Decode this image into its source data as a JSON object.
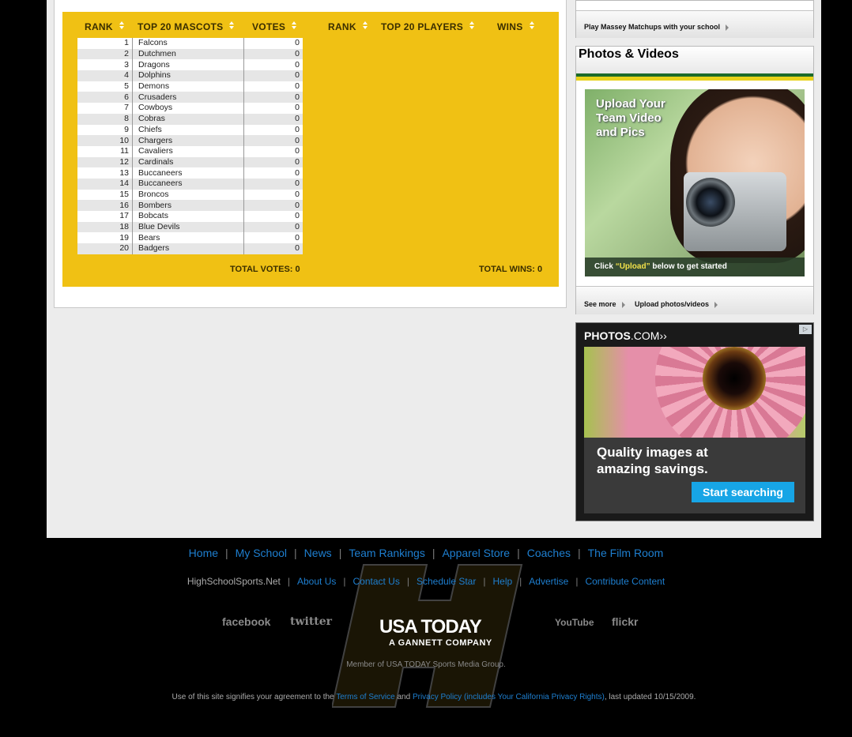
{
  "leaderboard": {
    "headers": {
      "rank1": "RANK",
      "mascots": "TOP 20 MASCOTS",
      "votes": "VOTES",
      "rank2": "RANK",
      "players": "TOP 20 PLAYERS",
      "wins": "WINS"
    },
    "mascots": [
      {
        "rank": "1",
        "name": "Falcons",
        "votes": "0"
      },
      {
        "rank": "2",
        "name": "Dutchmen",
        "votes": "0"
      },
      {
        "rank": "3",
        "name": "Dragons",
        "votes": "0"
      },
      {
        "rank": "4",
        "name": "Dolphins",
        "votes": "0"
      },
      {
        "rank": "5",
        "name": "Demons",
        "votes": "0"
      },
      {
        "rank": "6",
        "name": "Crusaders",
        "votes": "0"
      },
      {
        "rank": "7",
        "name": "Cowboys",
        "votes": "0"
      },
      {
        "rank": "8",
        "name": "Cobras",
        "votes": "0"
      },
      {
        "rank": "9",
        "name": "Chiefs",
        "votes": "0"
      },
      {
        "rank": "10",
        "name": "Chargers",
        "votes": "0"
      },
      {
        "rank": "11",
        "name": "Cavaliers",
        "votes": "0"
      },
      {
        "rank": "12",
        "name": "Cardinals",
        "votes": "0"
      },
      {
        "rank": "13",
        "name": "Buccaneers",
        "votes": "0"
      },
      {
        "rank": "14",
        "name": "Buccaneers",
        "votes": "0"
      },
      {
        "rank": "15",
        "name": "Broncos",
        "votes": "0"
      },
      {
        "rank": "16",
        "name": "Bombers",
        "votes": "0"
      },
      {
        "rank": "17",
        "name": "Bobcats",
        "votes": "0"
      },
      {
        "rank": "18",
        "name": "Blue Devils",
        "votes": "0"
      },
      {
        "rank": "19",
        "name": "Bears",
        "votes": "0"
      },
      {
        "rank": "20",
        "name": "Badgers",
        "votes": "0"
      }
    ],
    "total_votes": "TOTAL VOTES: 0",
    "total_wins": "TOTAL WINS: 0"
  },
  "sidebar": {
    "massey_link": "Play Massey Matchups with your school",
    "photos_title": "Photos & Videos",
    "upload_promo": {
      "headline_1": "Upload Your",
      "headline_2": "Team Video",
      "headline_3": "and Pics",
      "strip_prefix": "Click ",
      "strip_highlight": "“Upload”",
      "strip_suffix": " below to get started"
    },
    "see_more": "See more",
    "upload_link": "Upload photos/videos"
  },
  "ad": {
    "brand_bold": "PHOTOS",
    "brand_rest": ".COM",
    "brand_chev": "››",
    "tagline_1": "Quality images at",
    "tagline_2": "amazing savings.",
    "cta": "Start searching",
    "colors": {
      "cta": "#17a5e6"
    }
  },
  "footer": {
    "nav": [
      "Home",
      "My School",
      "News",
      "Team Rankings",
      "Apparel Store",
      "Coaches",
      "The Film Room"
    ],
    "site_name": "HighSchoolSports.Net",
    "nav2": [
      "About Us",
      "Contact Us",
      "Schedule Star",
      "Help",
      "Advertise",
      "Contribute Content"
    ],
    "social": {
      "facebook": "facebook",
      "twitter": "twitter",
      "youtube": "YouTube",
      "flickr": "flickr"
    },
    "usa_today": "USA TODAY",
    "gannett": "A GANNETT COMPANY",
    "member": "Member of USA TODAY Sports Media Group.",
    "legal_prefix": "Use of this site signifies your agreement to the ",
    "terms": "Terms of Service",
    "legal_and": " and ",
    "privacy": "Privacy Policy (includes Your California Privacy Rights)",
    "legal_suffix": ", last updated 10/15/2009.",
    "colors": {
      "link": "#1e7fd0",
      "accent_yellow": "#f0c114"
    }
  }
}
